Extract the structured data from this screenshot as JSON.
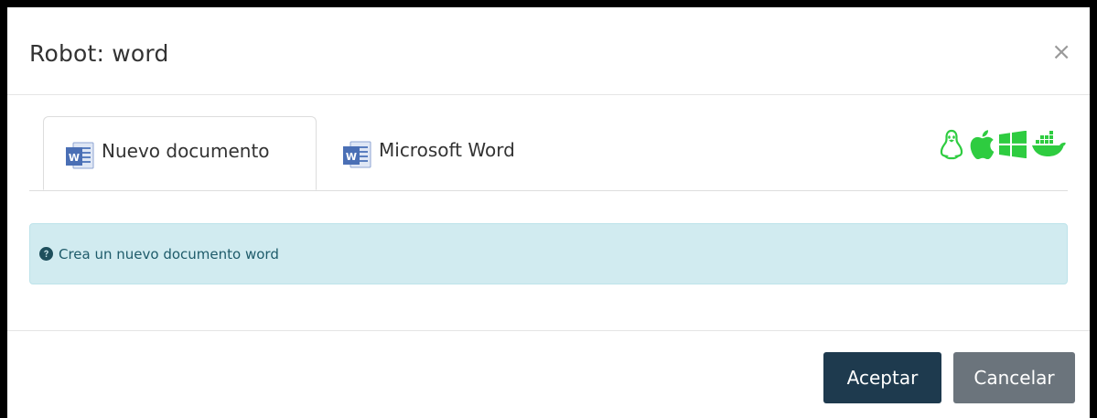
{
  "modal": {
    "title": "Robot: word",
    "close_label": "×"
  },
  "tabs": [
    {
      "label": "Nuevo documento",
      "icon": "word-icon",
      "active": true
    },
    {
      "label": "Microsoft Word",
      "icon": "word-icon",
      "active": false
    }
  ],
  "platforms": [
    "linux-icon",
    "apple-icon",
    "windows-icon",
    "docker-icon"
  ],
  "alert": {
    "icon": "question-circle-icon",
    "text": "Crea un nuevo documento word"
  },
  "footer": {
    "accept_label": "Aceptar",
    "cancel_label": "Cancelar"
  },
  "colors": {
    "platform_green": "#2ecc40",
    "accept_bg": "#1e3a4e",
    "cancel_bg": "#6b747c",
    "alert_bg": "#d1ebf0",
    "word_blue": "#5b7fc0"
  }
}
